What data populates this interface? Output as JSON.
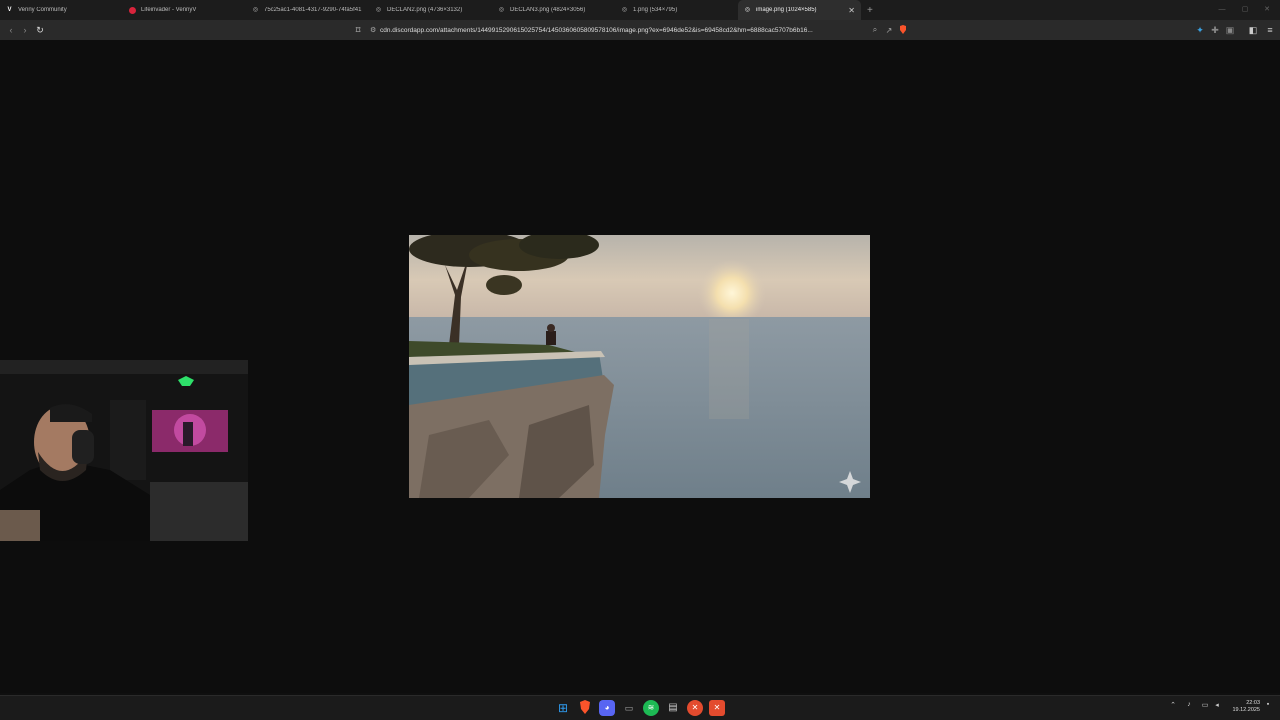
{
  "tabs": [
    {
      "title": "Venny Community",
      "icon": "venny-icon",
      "glyph": "V"
    },
    {
      "title": "Lifeinvader - VennyV",
      "icon": "lifeinvader-icon",
      "glyph": ""
    },
    {
      "title": "75c25ac1-4081-4317-9290-74fa5f41",
      "icon": "globe-icon",
      "glyph": "◎"
    },
    {
      "title": "DECLAN2.png (4736×3132)",
      "icon": "globe-icon",
      "glyph": "◎"
    },
    {
      "title": "DECLAN3.png (4824×3056)",
      "icon": "globe-icon",
      "glyph": "◎"
    },
    {
      "title": "1.png (534×795)",
      "icon": "globe-icon",
      "glyph": "◎"
    },
    {
      "title": "image.png (1024×585)",
      "icon": "globe-icon",
      "glyph": "◎",
      "active": true
    }
  ],
  "address": {
    "url": "cdn.discordapp.com/attachments/1449915290615025754/1450360605809578106/image.png?ex=6946de52&is=69458cd2&hm=6888cac5707b6b16..."
  },
  "clock": {
    "time": "22:03",
    "date": "19.12.2025"
  },
  "colors": {
    "accent_brave": "#fb542b",
    "spotify": "#1db954",
    "windows_blue": "#2f9cf0"
  }
}
